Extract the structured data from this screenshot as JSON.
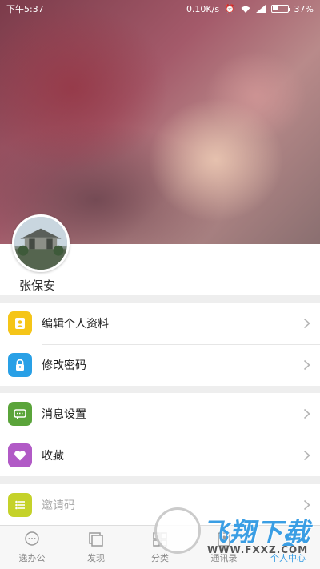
{
  "status_bar": {
    "time": "下午5:37",
    "network_speed": "0.10K/s",
    "battery_percent_text": "37%",
    "battery_level": 0.37
  },
  "profile": {
    "username": "张保安"
  },
  "menu": {
    "group1": [
      {
        "label": "编辑个人资料",
        "icon": "person-card-icon",
        "color": "#f5c518"
      },
      {
        "label": "修改密码",
        "icon": "lock-icon",
        "color": "#29a0e6"
      }
    ],
    "group2": [
      {
        "label": "消息设置",
        "icon": "message-icon",
        "color": "#5aa43a"
      },
      {
        "label": "收藏",
        "icon": "heart-icon",
        "color": "#b15ac6"
      }
    ],
    "group3": [
      {
        "label": "邀请码",
        "icon": "list-icon",
        "color": "#c5d22a"
      }
    ]
  },
  "tabbar": {
    "tabs": [
      {
        "label": "逸办公",
        "icon": "chat-bubble-icon",
        "active": false
      },
      {
        "label": "发现",
        "icon": "pages-icon",
        "active": false
      },
      {
        "label": "分类",
        "icon": "grid-icon",
        "active": false
      },
      {
        "label": "通讯录",
        "icon": "contacts-icon",
        "active": false
      },
      {
        "label": "个人中心",
        "icon": "person-icon",
        "active": true
      }
    ],
    "active_color": "#3a9ee4"
  },
  "watermark": {
    "title": "飞翔下载",
    "subtitle": "WWW.FXXZ.COM"
  }
}
